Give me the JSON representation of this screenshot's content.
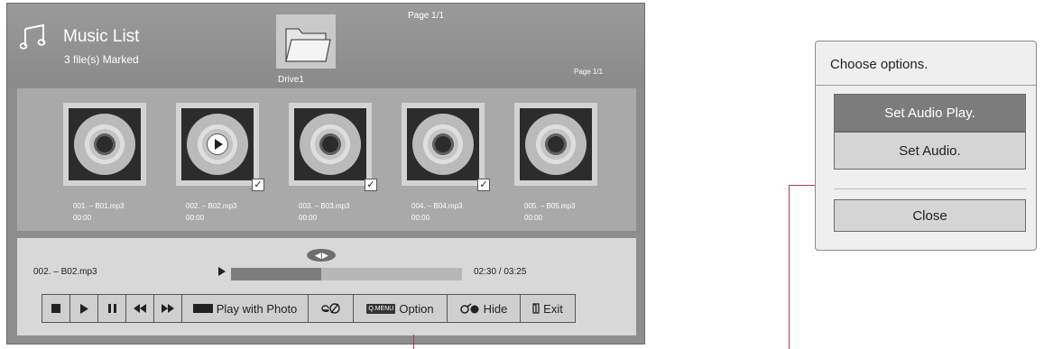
{
  "music_list": {
    "title": "Music List",
    "marked": "3 file(s) Marked",
    "drive_label": "Drive1",
    "page_top": "Page 1/1",
    "page_right": "Page 1/1"
  },
  "tracks": [
    {
      "name": "001. – B01.mp3",
      "time": "00:00",
      "marked": false,
      "playing": false
    },
    {
      "name": "002. – B02.mp3",
      "time": "00:00",
      "marked": true,
      "playing": true
    },
    {
      "name": "003. – B03.mp3",
      "time": "00:00",
      "marked": true,
      "playing": false
    },
    {
      "name": "004. – B04.mp3",
      "time": "00:00",
      "marked": true,
      "playing": false
    },
    {
      "name": "005. – B05.mp3",
      "time": "00:00",
      "marked": false,
      "playing": false
    }
  ],
  "player": {
    "now_playing": "002. – B02.mp3",
    "time": "02:30 / 03:25",
    "progress": 0.39
  },
  "controls": {
    "stop_icon": "stop-icon",
    "play_icon": "play-icon",
    "pause_icon": "pause-icon",
    "rewind_icon": "rewind-icon",
    "forward_icon": "fast-forward-icon",
    "play_with_photo": "Play with Photo",
    "energy_icon": "energy-saving-icon",
    "qmenu_tag": "Q.MENU",
    "option": "Option",
    "hide": "Hide",
    "exit": "Exit"
  },
  "dialog": {
    "title": "Choose options.",
    "options": [
      "Set Audio Play.",
      "Set Audio."
    ],
    "selected_index": 0,
    "close": "Close"
  },
  "colors": {
    "pointer_line": "#b23a52",
    "selected_option": "#7c7c7c"
  }
}
